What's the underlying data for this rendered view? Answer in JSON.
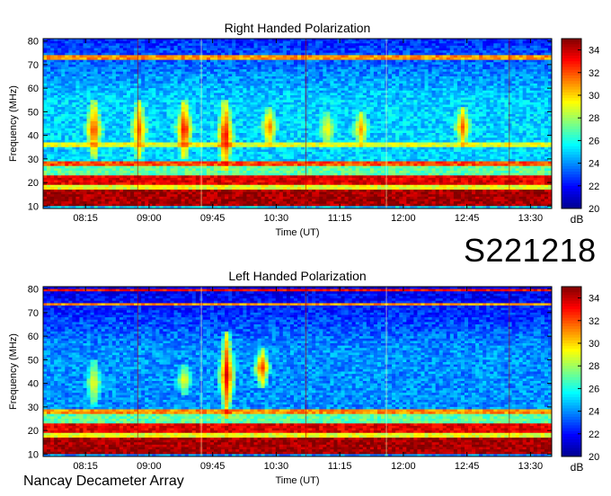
{
  "figure": {
    "observation_id": "S221218",
    "instrument": "Nancay Decameter Array"
  },
  "chart_data": [
    {
      "type": "heatmap",
      "title": "Right Handed Polarization",
      "xlabel": "Time (UT)",
      "ylabel": "Frequency (MHz)",
      "colorbar_label": "dB",
      "x_range": [
        "07:45",
        "13:45"
      ],
      "ylim": [
        9,
        81
      ],
      "x_ticks": [
        "08:15",
        "09:00",
        "09:45",
        "10:30",
        "11:15",
        "12:00",
        "12:45",
        "13:30"
      ],
      "y_ticks": [
        10,
        20,
        30,
        40,
        50,
        60,
        70,
        80
      ],
      "colorbar_range": [
        20,
        35
      ],
      "colorbar_ticks": [
        20,
        22,
        24,
        26,
        28,
        30,
        32,
        34
      ],
      "colormap": [
        "#00008f",
        "#0000ff",
        "#0080ff",
        "#00ffff",
        "#80ff80",
        "#ffff00",
        "#ff8000",
        "#ff0000",
        "#800000"
      ],
      "background_level_db": 25,
      "interference_bands": [
        {
          "freq": [
            10,
            17
          ],
          "level_db": 34.5
        },
        {
          "freq": [
            17,
            19
          ],
          "level_db": 29
        },
        {
          "freq": [
            19,
            23
          ],
          "level_db": 33.5
        },
        {
          "freq": [
            23,
            27
          ],
          "level_db": 27
        },
        {
          "freq": [
            27,
            29
          ],
          "level_db": 32
        },
        {
          "freq": [
            72.5,
            74
          ],
          "level_db": 31
        },
        {
          "freq": [
            35.5,
            36.5
          ],
          "level_db": 29
        }
      ],
      "bursts": [
        {
          "time": "08:21",
          "freq": [
            30,
            55
          ],
          "level_db": 33
        },
        {
          "time": "08:53",
          "freq": [
            30,
            55
          ],
          "level_db": 32
        },
        {
          "time": "09:25",
          "freq": [
            30,
            55
          ],
          "level_db": 34
        },
        {
          "time": "09:54",
          "freq": [
            25,
            55
          ],
          "level_db": 34
        },
        {
          "time": "10:25",
          "freq": [
            35,
            52
          ],
          "level_db": 32
        },
        {
          "time": "11:06",
          "freq": [
            35,
            50
          ],
          "level_db": 30
        },
        {
          "time": "11:30",
          "freq": [
            35,
            50
          ],
          "level_db": 31
        },
        {
          "time": "12:42",
          "freq": [
            35,
            52
          ],
          "level_db": 32
        }
      ]
    },
    {
      "type": "heatmap",
      "title": "Left Handed Polarization",
      "xlabel": "Time (UT)",
      "ylabel": "Frequency (MHz)",
      "colorbar_label": "dB",
      "x_range": [
        "07:45",
        "13:45"
      ],
      "ylim": [
        9,
        81
      ],
      "x_ticks": [
        "08:15",
        "09:00",
        "09:45",
        "10:30",
        "11:15",
        "12:00",
        "12:45",
        "13:30"
      ],
      "y_ticks": [
        10,
        20,
        30,
        40,
        50,
        60,
        70,
        80
      ],
      "colorbar_range": [
        20,
        35
      ],
      "colorbar_ticks": [
        20,
        22,
        24,
        26,
        28,
        30,
        32,
        34
      ],
      "colormap": [
        "#00008f",
        "#0000ff",
        "#0080ff",
        "#00ffff",
        "#80ff80",
        "#ffff00",
        "#ff8000",
        "#ff0000",
        "#800000"
      ],
      "background_level_db": 24,
      "interference_bands": [
        {
          "freq": [
            10,
            17
          ],
          "level_db": 34.5
        },
        {
          "freq": [
            17,
            19
          ],
          "level_db": 29
        },
        {
          "freq": [
            19,
            23
          ],
          "level_db": 33.5
        },
        {
          "freq": [
            23,
            27
          ],
          "level_db": 27
        },
        {
          "freq": [
            27,
            29
          ],
          "level_db": 31
        },
        {
          "freq": [
            73,
            74
          ],
          "level_db": 31
        },
        {
          "freq": [
            79,
            80
          ],
          "level_db": 33
        }
      ],
      "bursts": [
        {
          "time": "08:21",
          "freq": [
            30,
            50
          ],
          "level_db": 30
        },
        {
          "time": "09:25",
          "freq": [
            35,
            48
          ],
          "level_db": 30
        },
        {
          "time": "09:55",
          "freq": [
            25,
            62
          ],
          "level_db": 34
        },
        {
          "time": "10:20",
          "freq": [
            38,
            55
          ],
          "level_db": 33
        }
      ]
    }
  ]
}
